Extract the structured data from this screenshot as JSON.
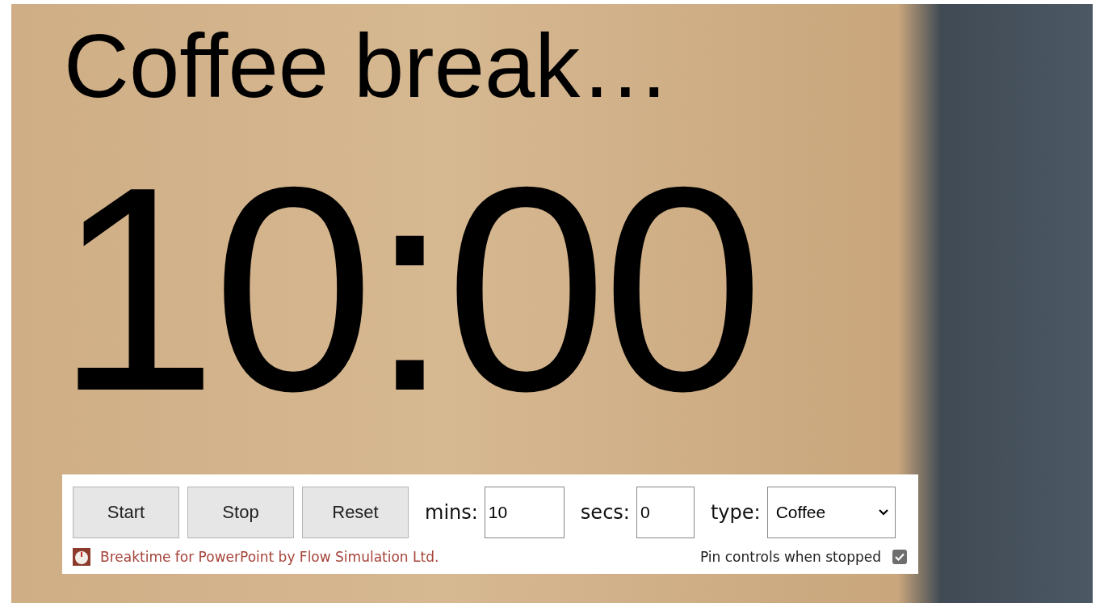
{
  "title": "Coffee break…",
  "timer": "10:00",
  "controls": {
    "buttons": [
      "Start",
      "Stop",
      "Reset"
    ],
    "fields": [
      {
        "label": "mins:",
        "value": "10"
      },
      {
        "label": "secs:",
        "value": "0"
      }
    ],
    "type": {
      "label": "type:",
      "value": "Coffee"
    }
  },
  "footer": {
    "link": "Breaktime for PowerPoint by Flow Simulation Ltd.",
    "pin": {
      "label": "Pin controls when stopped",
      "checked": true
    }
  }
}
